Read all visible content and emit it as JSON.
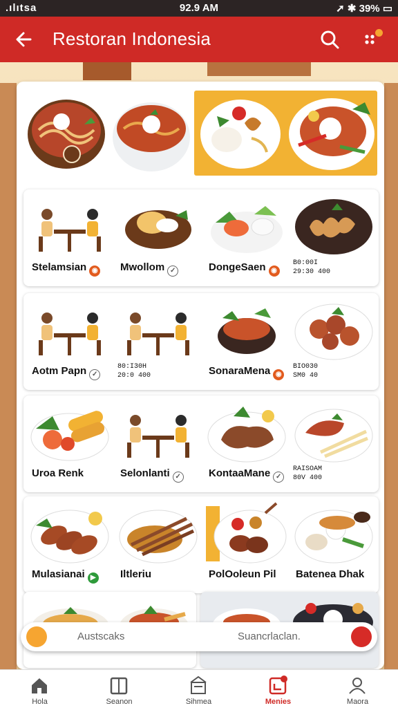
{
  "status_bar": {
    "signal": ".ılıtsa",
    "time": "92.9 AM",
    "battery": "39%"
  },
  "app_bar": {
    "title": "Restoran Indonesia",
    "back_icon": "arrow-left-icon",
    "search_icon": "search-icon",
    "more_icon": "more-dots-icon"
  },
  "colors": {
    "primary": "#cf2a26",
    "accent": "#f2b233",
    "badge_orange": "#e25b1e",
    "badge_green": "#2e9a3a"
  },
  "rows": [
    {
      "cells": [
        {
          "type": "label",
          "label": "Stelamsian",
          "badge": "orange",
          "icon": "diners-icon"
        },
        {
          "type": "label",
          "label": "Mwollom",
          "badge": "outline",
          "icon": "bread-bowl-icon"
        },
        {
          "type": "label",
          "label": "DongeSaen",
          "badge": "orange",
          "icon": "salad-bowl-icon"
        },
        {
          "type": "meta",
          "meta": [
            "B0:00I",
            "29:30 400"
          ],
          "icon": "fried-chicken-plate-icon"
        }
      ]
    },
    {
      "cells": [
        {
          "type": "label",
          "label": "Aotm Papn",
          "badge": "outline",
          "icon": "diners-icon"
        },
        {
          "type": "meta",
          "meta": [
            "80:I30H",
            "20:0 400"
          ],
          "icon": "diners-icon"
        },
        {
          "type": "label",
          "label": "SonaraMena",
          "badge": "orange",
          "icon": "rendang-bowl-icon"
        },
        {
          "type": "meta",
          "meta": [
            "BIO030",
            "SM0 40"
          ],
          "icon": "meatball-plate-icon"
        }
      ]
    },
    {
      "cells": [
        {
          "type": "label",
          "label": "Uroa Renk",
          "badge": "none",
          "icon": "spring-roll-plate-icon"
        },
        {
          "type": "label",
          "label": "Selonlanti",
          "badge": "outline",
          "icon": "diners-icon"
        },
        {
          "type": "label",
          "label": "KontaaMane",
          "badge": "outline",
          "icon": "roast-chicken-plate-icon"
        },
        {
          "type": "meta",
          "meta": [
            "RAISOAM",
            "80V 400"
          ],
          "icon": "fish-fries-plate-icon"
        }
      ]
    },
    {
      "cells": [
        {
          "type": "label",
          "label": "Mulasianai",
          "badge": "green",
          "icon": "fried-fish-plate-icon"
        },
        {
          "type": "label",
          "label": "Iltleriu",
          "badge": "none",
          "icon": "satay-plate-icon"
        },
        {
          "type": "label",
          "label": "PolOoleun Pil",
          "badge": "none",
          "icon": "grilled-platter-icon"
        },
        {
          "type": "label",
          "label": "Batenea Dhak",
          "badge": "none",
          "icon": "nasi-campur-icon"
        }
      ]
    }
  ],
  "float_bar": {
    "left_text": "Austscaks",
    "right_text": "Suancrlaclan."
  },
  "bottom_nav": [
    {
      "label": "Hola",
      "icon": "home-icon",
      "active": false
    },
    {
      "label": "Seanon",
      "icon": "tablet-icon",
      "active": false
    },
    {
      "label": "Sihmea",
      "icon": "menu-board-icon",
      "active": false
    },
    {
      "label": "Menies",
      "icon": "orders-icon",
      "active": true
    },
    {
      "label": "Maora",
      "icon": "profile-icon",
      "active": false
    }
  ]
}
